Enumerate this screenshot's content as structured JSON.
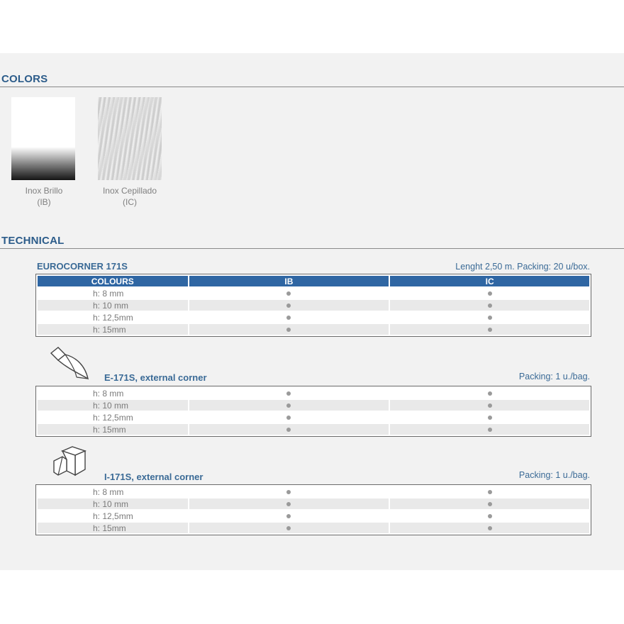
{
  "sections": {
    "colors_title": "COLORS",
    "technical_title": "TECHNICAL"
  },
  "colors": [
    {
      "name": "Inox Brillo",
      "code": "(IB)"
    },
    {
      "name": "Inox Cepillado",
      "code": "(IC)"
    }
  ],
  "tables": {
    "main": {
      "title": "EUROCORNER 171S",
      "note": "Lenght 2,50 m. Packing: 20 u/box.",
      "headers": [
        "COLOURS",
        "IB",
        "IC"
      ],
      "rows": [
        "h: 8 mm",
        "h: 10 mm",
        "h: 12,5mm",
        "h: 15mm"
      ]
    },
    "external": {
      "title": "E-171S, external corner",
      "note": "Packing: 1 u./bag.",
      "icon": "external-corner-icon",
      "rows": [
        "h: 8 mm",
        "h: 10 mm",
        "h: 12,5mm",
        "h: 15mm"
      ]
    },
    "internal": {
      "title": "I-171S, external corner",
      "note": "Packing: 1 u./bag.",
      "icon": "internal-corner-icon",
      "rows": [
        "h: 8 mm",
        "h: 10 mm",
        "h: 12,5mm",
        "h: 15mm"
      ]
    }
  }
}
